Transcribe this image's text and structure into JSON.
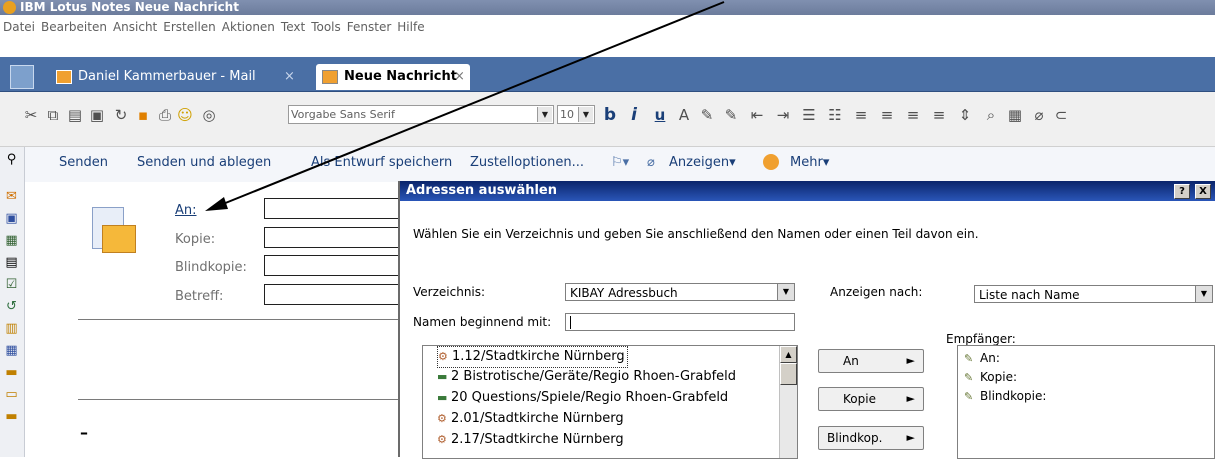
{
  "window": {
    "title": "IBM Lotus Notes Neue Nachricht"
  },
  "menu": [
    "Datei",
    "Bearbeiten",
    "Ansicht",
    "Erstellen",
    "Aktionen",
    "Text",
    "Tools",
    "Fenster",
    "Hilfe"
  ],
  "tabs": [
    {
      "label": "Daniel Kammerbauer - Mail",
      "close": "×"
    },
    {
      "label": "Neue Nachricht",
      "close": "×"
    }
  ],
  "toolbar": {
    "font": "Vorgabe Sans Serif",
    "size": "10",
    "bold": "b",
    "italic": "i",
    "underline": "u"
  },
  "actions": [
    "Senden",
    "Senden und ablegen",
    "Als Entwurf speichern",
    "Zustelloptionen...",
    "Anzeigen",
    "Mehr"
  ],
  "address": {
    "to": "An:",
    "cc": "Kopie:",
    "bcc": "Blindkopie:",
    "subject": "Betreff:"
  },
  "body_cursor": "–",
  "dialog": {
    "title": "Adressen auswählen",
    "help": "?",
    "close": "X",
    "instruction": "Wählen Sie ein Verzeichnis und geben Sie anschließend den Namen oder einen Teil davon ein.",
    "directory_label": "Verzeichnis:",
    "directory_value": "KIBAY Adressbuch",
    "show_by_label": "Anzeigen nach:",
    "show_by_value": "Liste nach Name",
    "starts_with_label": "Namen beginnend mit:",
    "starts_with_value": "",
    "recipients_label": "Empfänger:",
    "names": [
      "1.12/Stadtkirche Nürnberg",
      "2 Bistrotische/Geräte/Regio Rhoen-Grabfeld",
      "20 Questions/Spiele/Regio Rhoen-Grabfeld",
      "2.01/Stadtkirche Nürnberg",
      "2.17/Stadtkirche Nürnberg"
    ],
    "buttons": [
      "An",
      "Kopie",
      "Blindkop."
    ],
    "recipients": [
      "An:",
      "Kopie:",
      "Blindkopie:"
    ]
  },
  "colors": {
    "tabbar": "#4a6fa5",
    "dialog_title": "#0a246a",
    "link": "#1a3f78"
  }
}
